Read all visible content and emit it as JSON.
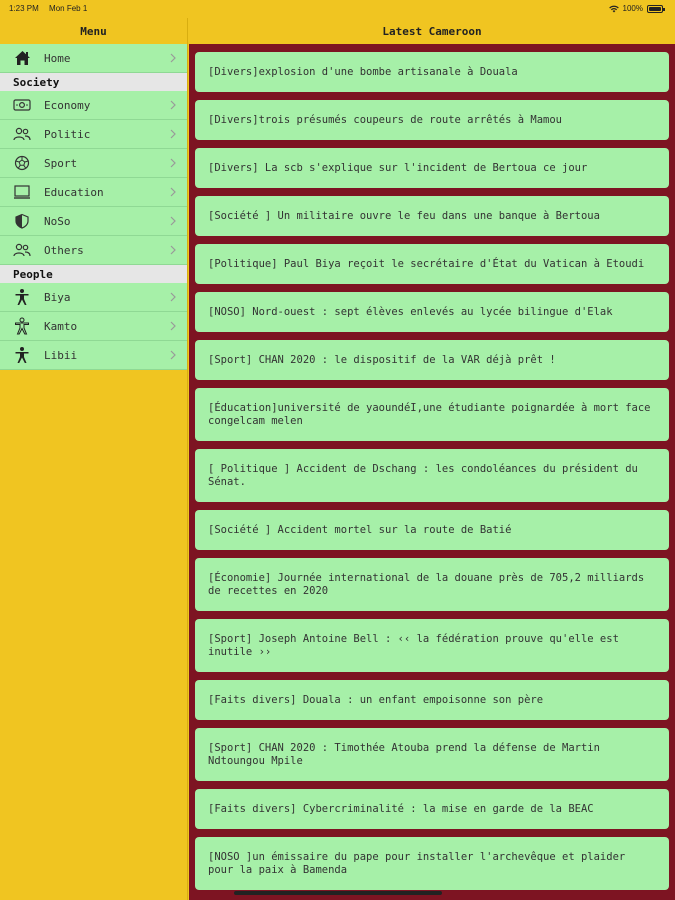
{
  "status_bar": {
    "time": "1:23 PM",
    "date": "Mon Feb 1",
    "battery": "100%"
  },
  "sidebar": {
    "title": "Menu",
    "home": {
      "label": "Home",
      "icon": "home-icon"
    },
    "sections": [
      {
        "title": "Society",
        "items": [
          {
            "label": "Economy",
            "icon": "money-icon"
          },
          {
            "label": "Politic",
            "icon": "people-icon"
          },
          {
            "label": "Sport",
            "icon": "ball-icon"
          },
          {
            "label": "Education",
            "icon": "book-icon"
          },
          {
            "label": "NoSo",
            "icon": "shield-icon"
          },
          {
            "label": "Others",
            "icon": "people-icon"
          }
        ]
      },
      {
        "title": "People",
        "items": [
          {
            "label": "Biya",
            "icon": "person-icon"
          },
          {
            "label": "Kamto",
            "icon": "person-icon"
          },
          {
            "label": "Libii",
            "icon": "person-icon"
          }
        ]
      }
    ]
  },
  "content": {
    "title": "Latest Cameroon",
    "news": [
      "[Divers]explosion d'une bombe artisanale à Douala",
      "[Divers]trois présumés coupeurs de route arrêtés à Mamou",
      "[Divers] La scb s'explique sur l'incident de Bertoua ce jour",
      "[Société ] Un militaire ouvre le feu dans une banque à Bertoua",
      "[Politique] Paul Biya reçoit le secrétaire d'État du Vatican à Etoudi",
      "[NOSO] Nord-ouest : sept élèves enlevés au lycée bilingue d'Elak",
      "[Sport] CHAN 2020 : le dispositif de la VAR déjà prêt !",
      "[Éducation]université de yaoundéI,une étudiante poignardée à mort face congelcam melen",
      "[ Politique ] Accident de Dschang : les condoléances du président du Sénat.",
      "[Société ] Accident mortel sur la route de Batié",
      "[Économie] Journée international de la douane près de 705,2 milliards de recettes en 2020",
      "[Sport] Joseph Antoine Bell : ‹‹ la fédération prouve qu'elle est inutile ››",
      "[Faits divers] Douala : un enfant empoisonne son père",
      "[Sport] CHAN 2020 : Timothée Atouba prend la défense de Martin Ndtoungou Mpile",
      "[Faits divers] Cybercriminalité : la mise en garde de la BEAC",
      "[NOSO ]un émissaire du pape pour installer l'archevêque et plaider pour la paix à Bamenda"
    ]
  }
}
